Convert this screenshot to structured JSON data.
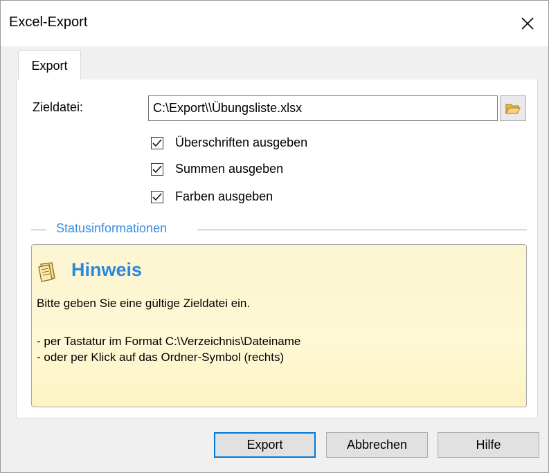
{
  "window": {
    "title": "Excel-Export",
    "close_glyph": "✕"
  },
  "tabs": [
    {
      "label": "Export",
      "active": true
    }
  ],
  "form": {
    "target_label": "Zieldatei:",
    "target_value": "C:\\Export\\\\Übungsliste.xlsx",
    "browse_icon": "folder-open-icon",
    "checkboxes": [
      {
        "label": "Überschriften ausgeben",
        "checked": true
      },
      {
        "label": "Summen ausgeben",
        "checked": true
      },
      {
        "label": "Farben ausgeben",
        "checked": true
      }
    ]
  },
  "status": {
    "group_title": "Statusinformationen",
    "hint_icon": "notepad-icon",
    "hint_title": "Hinweis",
    "hint_message": "Bitte geben Sie eine gültige Zieldatei ein.",
    "hint_line1": "- per Tastatur im Format C:\\Verzeichnis\\Dateiname",
    "hint_line2": "- oder per Klick auf das Ordner-Symbol (rechts)"
  },
  "buttons": {
    "export": "Export",
    "cancel": "Abbrechen",
    "help": "Hilfe"
  },
  "colors": {
    "accent": "#0078d7",
    "group_title": "#3c8dde",
    "hint_title": "#2e86de",
    "hint_background": "#fef8d4"
  }
}
